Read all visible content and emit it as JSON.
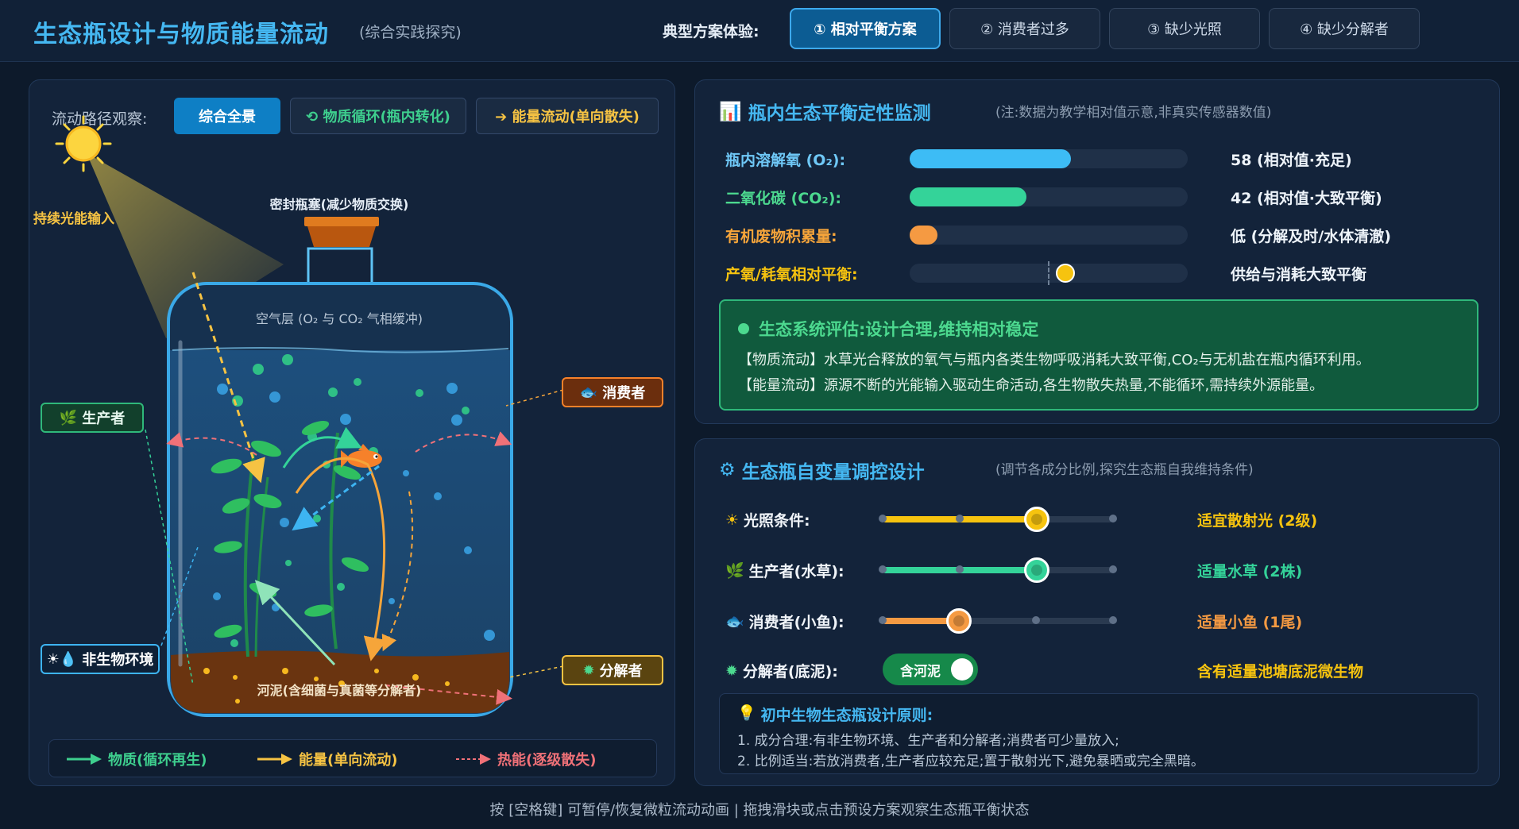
{
  "header": {
    "title": "生态瓶设计与物质能量流动",
    "subtitle": "(综合实践探究)",
    "scenario_label": "典型方案体验:",
    "scenarios": [
      {
        "label": "① 相对平衡方案",
        "active": true
      },
      {
        "label": "② 消费者过多",
        "active": false
      },
      {
        "label": "③ 缺少光照",
        "active": false
      },
      {
        "label": "④ 缺少分解者",
        "active": false
      }
    ]
  },
  "diagram": {
    "path_label": "流动路径观察:",
    "path_buttons": [
      {
        "label": "综合全景",
        "active": true,
        "color": "#ffffff"
      },
      {
        "label": "⟲ 物质循环(瓶内转化)",
        "active": false,
        "color": "#3ecf8e"
      },
      {
        "label": "➔ 能量流动(单向散失)",
        "active": false,
        "color": "#f6c343"
      }
    ],
    "sun_label": "持续光能输入",
    "stopper_label": "密封瓶塞(减少物质交换)",
    "air_label": "空气层 (O₂ 与 CO₂ 气相缓冲)",
    "mud_label": "河泥(含细菌与真菌等分解者)",
    "tags": {
      "producer": "生产者",
      "consumer": "消费者",
      "abiotic": "非生物环境",
      "decomposer": "分解者"
    },
    "legend": [
      {
        "label": "物质(循环再生)",
        "color": "#3ecf8e"
      },
      {
        "label": "能量(单向流动)",
        "color": "#f6c343"
      },
      {
        "label": "热能(逐级散失)",
        "color": "#f07178"
      }
    ]
  },
  "monitor": {
    "title": "瓶内生态平衡定性监测",
    "note": "(注:数据为教学相对值示意,非真实传感器数值)",
    "metrics": [
      {
        "label": "瓶内溶解氧 (O₂):",
        "value": "58 (相对值·充足)",
        "level": 0.58,
        "color": "#3dbcf5"
      },
      {
        "label": "二氧化碳 (CO₂):",
        "value": "42 (相对值·大致平衡)",
        "level": 0.42,
        "color": "#34d399"
      },
      {
        "label": "有机废物积累量:",
        "value": "低 (分解及时/水体清澈)",
        "level": 0.1,
        "color": "#f59a42"
      },
      {
        "label": "产氧/耗氧相对平衡:",
        "value": "供给与消耗大致平衡",
        "level": 0.56,
        "color": "#f6c30f"
      }
    ],
    "assessment": {
      "title": "生态系统评估:设计合理,维持相对稳定",
      "lines": [
        "【物质流动】水草光合释放的氧气与瓶内各类生物呼吸消耗大致平衡,CO₂与无机盐在瓶内循环利用。",
        "【能量流动】源源不断的光能输入驱动生命活动,各生物散失热量,不能循环,需持续外源能量。"
      ]
    }
  },
  "controls": {
    "title": "生态瓶自变量调控设计",
    "note": "(调节各成分比例,探究生态瓶自我维持条件)",
    "sliders": [
      {
        "label": "光照条件:",
        "icon": "☀",
        "value": "适宜散射光 (2级)",
        "level": 0.67,
        "color": "#f6c30f"
      },
      {
        "label": "生产者(水草):",
        "icon": "🌿",
        "value": "适量水草 (2株)",
        "level": 0.67,
        "color": "#34d399"
      },
      {
        "label": "消费者(小鱼):",
        "icon": "🐟",
        "value": "适量小鱼 (1尾)",
        "level": 0.33,
        "color": "#f59a42"
      }
    ],
    "toggle": {
      "label": "分解者(底泥):",
      "icon": "✹",
      "state": "含河泥",
      "value": "含有适量池塘底泥微生物",
      "color": "#f6c30f"
    },
    "principles": {
      "title": "初中生物生态瓶设计原则:",
      "lines": [
        "1. 成分合理:有非生物环境、生产者和分解者;消费者可少量放入;",
        "2. 比例适当:若放消费者,生产者应较充足;置于散射光下,避免暴晒或完全黑暗。"
      ]
    }
  },
  "footer": "按 [空格键] 可暂停/恢复微粒流动动画  |  拖拽滑块或点击预设方案观察生态瓶平衡状态"
}
